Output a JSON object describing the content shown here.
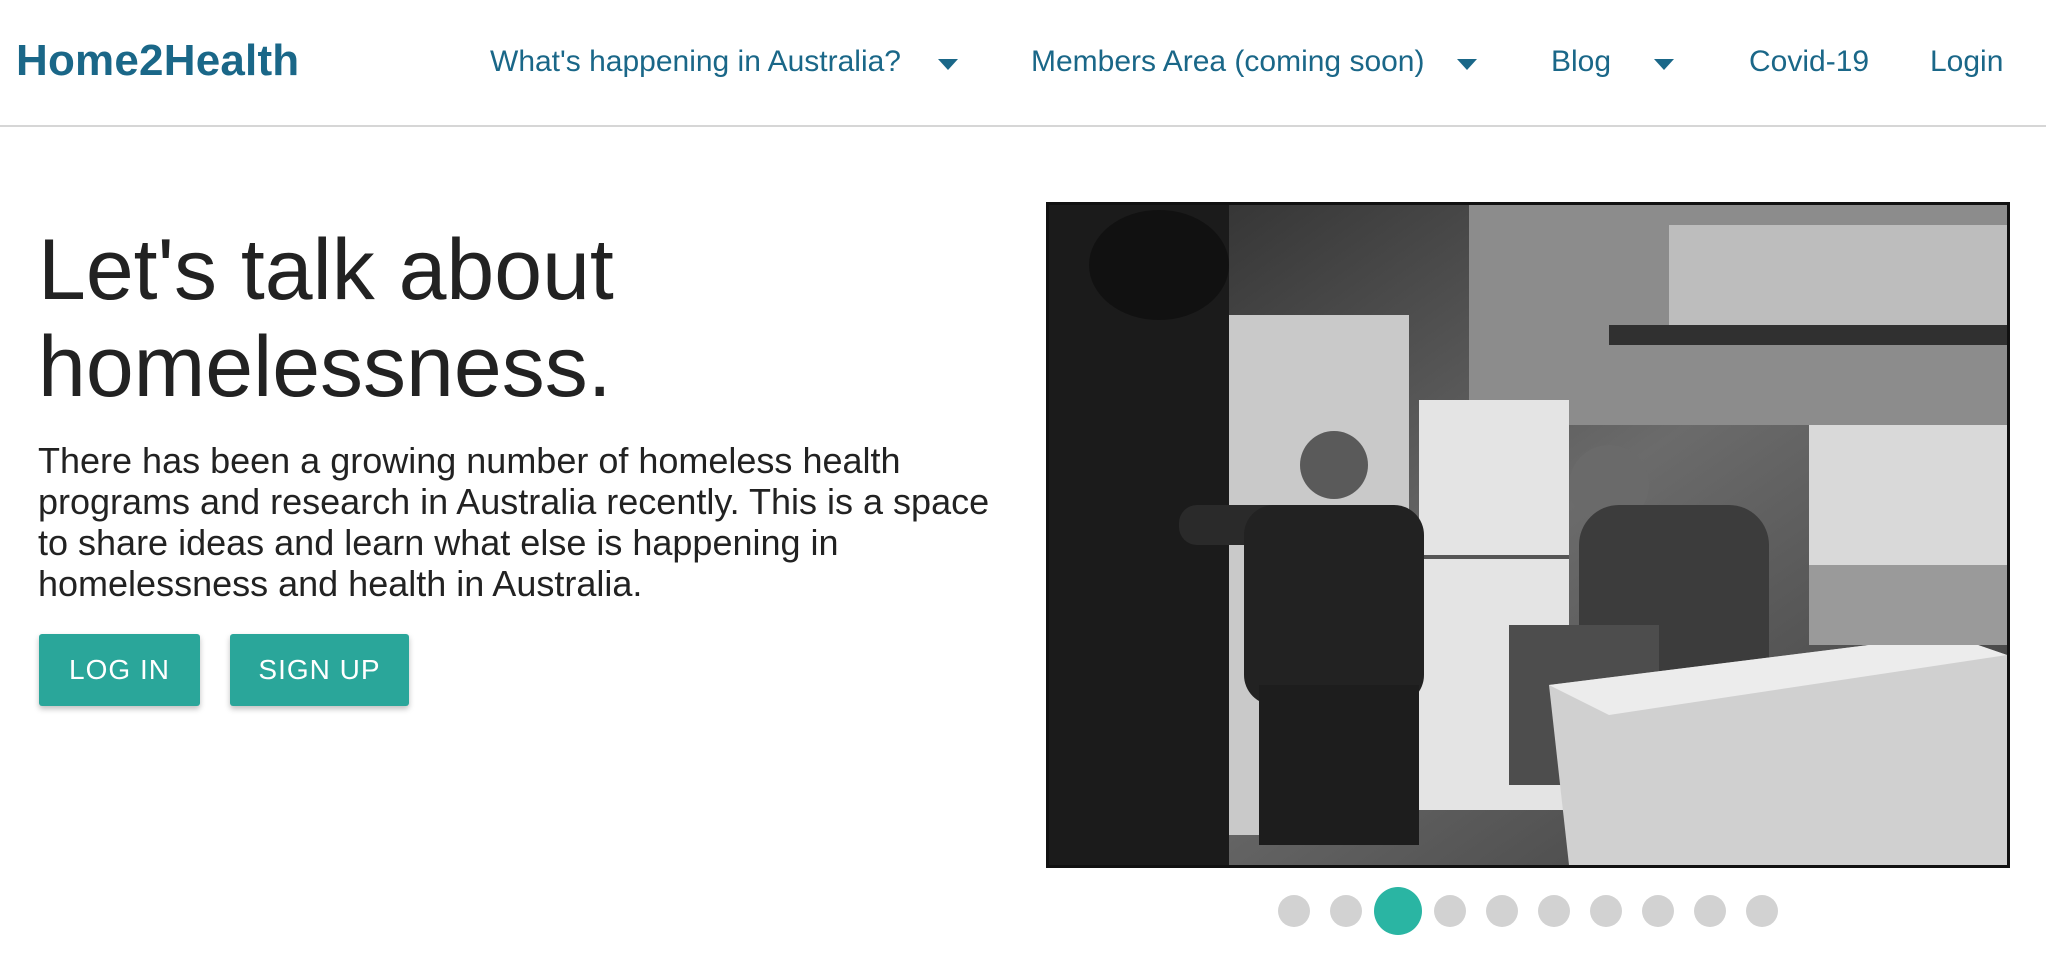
{
  "header": {
    "brand": "Home2Health",
    "nav": [
      {
        "label": "What's happening in Australia?",
        "has_dropdown": true
      },
      {
        "label": "Members Area (coming soon)",
        "has_dropdown": true
      },
      {
        "label": "Blog",
        "has_dropdown": true
      },
      {
        "label": "Covid-19",
        "has_dropdown": false
      },
      {
        "label": "Login",
        "has_dropdown": false
      }
    ]
  },
  "hero": {
    "title_line1": "Let's talk about",
    "title_line2": "homelessness.",
    "description": "There has been a growing number of homeless health programs and research in Australia recently. This is a space to share ideas and learn what else is happening in homelessness and health in Australia.",
    "login_label": "LOG IN",
    "signup_label": "SIGN UP"
  },
  "carousel": {
    "slide_count": 10,
    "active_slide": 3
  },
  "colors": {
    "brand_blue": "#1a6788",
    "button_teal": "#2aa69a",
    "dot_active": "#2ab5a3",
    "dot_inactive": "#d2d2d2",
    "text_dark": "#222222"
  }
}
